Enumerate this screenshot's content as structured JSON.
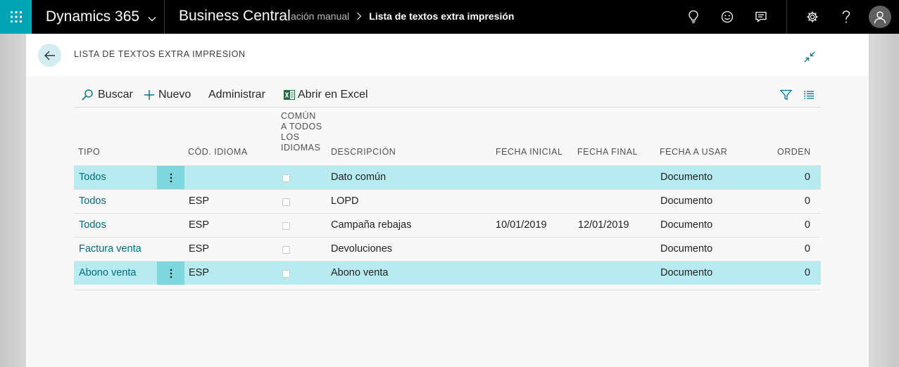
{
  "topbar": {
    "product": "Dynamics 365",
    "app": "Business Central",
    "breadcrumb_prev": "ación manual",
    "breadcrumb_current": "Lista de textos extra impresión",
    "icons": [
      "waffle-icon",
      "lightbulb-icon",
      "smiley-icon",
      "chat-icon",
      "gear-icon",
      "help-icon",
      "user-icon"
    ]
  },
  "page": {
    "title": "LISTA DE TEXTOS EXTRA IMPRESION"
  },
  "actions": {
    "search": "Buscar",
    "new": "Nuevo",
    "manage": "Administrar",
    "excel": "Abrir en Excel"
  },
  "table": {
    "columns": {
      "tipo": "TIPO",
      "idioma": "CÓD. IDIOMA",
      "comun": "COMÚN A TODOS LOS IDIOMAS",
      "descripcion": "DESCRIPCIÓN",
      "fecha_inicial": "FECHA INICIAL",
      "fecha_final": "FECHA FINAL",
      "fecha_usar": "FECHA A USAR",
      "orden": "ORDEN"
    },
    "rows": [
      {
        "tipo": "Todos",
        "idioma": "",
        "comun": false,
        "descripcion": "Dato común",
        "fecha_inicial": "",
        "fecha_final": "",
        "fecha_usar": "Documento",
        "orden": "0",
        "selected": true
      },
      {
        "tipo": "Todos",
        "idioma": "ESP",
        "comun": false,
        "descripcion": "LOPD",
        "fecha_inicial": "",
        "fecha_final": "",
        "fecha_usar": "Documento",
        "orden": "0",
        "selected": false
      },
      {
        "tipo": "Todos",
        "idioma": "ESP",
        "comun": false,
        "descripcion": "Campaña rebajas",
        "fecha_inicial": "10/01/2019",
        "fecha_final": "12/01/2019",
        "fecha_usar": "Documento",
        "orden": "0",
        "selected": false
      },
      {
        "tipo": "Factura venta",
        "idioma": "ESP",
        "comun": false,
        "descripcion": "Devoluciones",
        "fecha_inicial": "",
        "fecha_final": "",
        "fecha_usar": "Documento",
        "orden": "0",
        "selected": false
      },
      {
        "tipo": "Abono venta",
        "idioma": "ESP",
        "comun": false,
        "descripcion": "Abono venta",
        "fecha_inicial": "",
        "fecha_final": "",
        "fecha_usar": "Documento",
        "orden": "0",
        "selected": true
      }
    ]
  },
  "colors": {
    "accent": "#00a4b4",
    "link": "#006d7b",
    "selected_row": "#b7ebef",
    "row_menu": "#7dd7de",
    "excel_green": "#1e7145"
  }
}
